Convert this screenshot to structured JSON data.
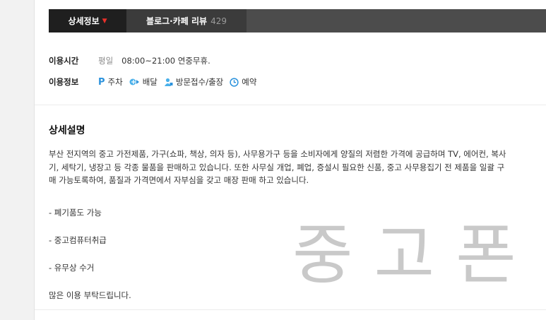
{
  "tabs": [
    {
      "label": "상세정보"
    },
    {
      "label": "블로그·카페 리뷰",
      "count": "429"
    }
  ],
  "hours": {
    "label": "이용시간",
    "day": "평일",
    "value": "08:00~21:00 연중무휴."
  },
  "features": {
    "label": "이용정보",
    "items": [
      {
        "label": "주차",
        "icon": "parking-icon"
      },
      {
        "label": "배달",
        "icon": "delivery-icon"
      },
      {
        "label": "방문접수/출장",
        "icon": "visit-icon"
      },
      {
        "label": "예약",
        "icon": "clock-icon"
      }
    ]
  },
  "description": {
    "title": "상세설명",
    "text": "부산 전지역의 중고 가전제품, 가구(쇼파, 책상, 의자 등), 사무용가구 등을 소비자에게 양질의 저렴한 가격에 공급하며 TV, 에어컨, 복사기, 세탁기, 냉장고 등 각종 물품을 판매하고 있습니다. 또한 사무실 개업, 폐업, 증설시 필요한 신품, 중고 사무용집기 전 제품을 일괄 구매 가능토록하여, 품질과 가격면에서 자부심을 갖고 매장 판매 하고 있습니다.",
    "bullets": [
      "- 폐기품도 가능",
      "- 중고컴퓨터취급",
      "- 유무상 수거"
    ],
    "closing": "많은 이용 부탁드립니다."
  },
  "watermark": "중고폰",
  "colors": {
    "accent": "#e8302a",
    "icon_blue": "#2b92dc",
    "tab_bg": "#4c4c4c",
    "tab_active_bg": "#1f1f1f"
  }
}
